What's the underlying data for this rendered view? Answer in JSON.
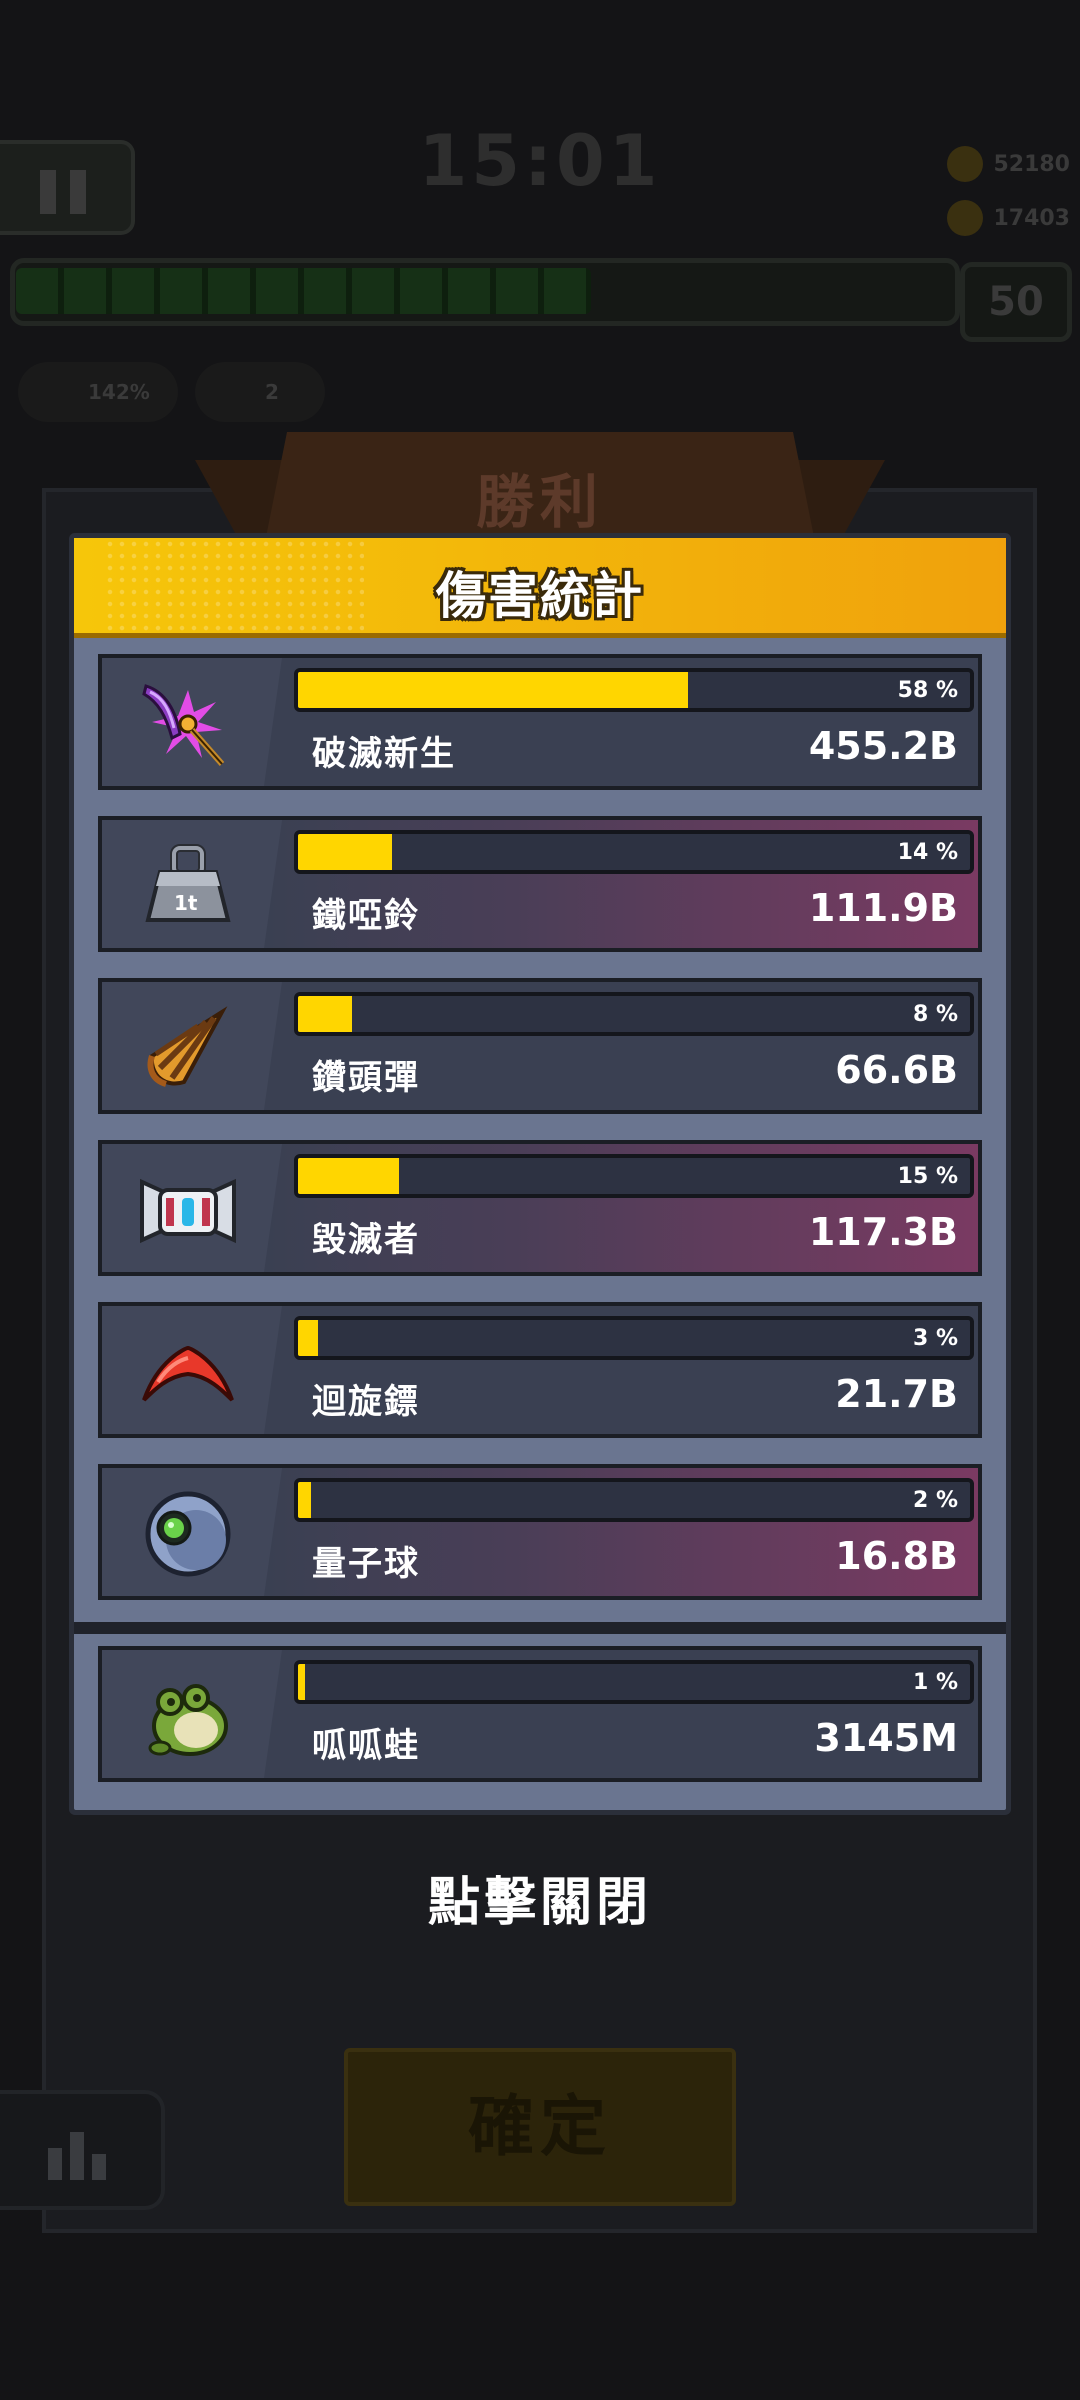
{
  "hud": {
    "timer": "15:01",
    "coins": "52180",
    "kills": "17403",
    "level": "50",
    "stat_a": "142%",
    "stat_b": "2"
  },
  "victory": {
    "title": "勝利"
  },
  "damage_panel": {
    "title": "傷害統計",
    "rows": [
      {
        "name": "破滅新生",
        "percent": 58,
        "percent_label": "58 %",
        "damage": "455.2B",
        "icon": "purple-scythe-icon"
      },
      {
        "name": "鐵啞鈴",
        "percent": 14,
        "percent_label": "14 %",
        "damage": "111.9B",
        "icon": "iron-dumbbell-icon"
      },
      {
        "name": "鑽頭彈",
        "percent": 8,
        "percent_label": "8 %",
        "damage": "66.6B",
        "icon": "drill-bullet-icon"
      },
      {
        "name": "毀滅者",
        "percent": 15,
        "percent_label": "15 %",
        "damage": "117.3B",
        "icon": "destroyer-robot-icon"
      },
      {
        "name": "迴旋鏢",
        "percent": 3,
        "percent_label": "3 %",
        "damage": "21.7B",
        "icon": "boomerang-icon"
      },
      {
        "name": "量子球",
        "percent": 2,
        "percent_label": "2 %",
        "damage": "16.8B",
        "icon": "quantum-orb-icon"
      }
    ],
    "pet_row": {
      "name": "呱呱蛙",
      "percent": 1,
      "percent_label": "1 %",
      "damage": "3145M",
      "icon": "frog-icon"
    }
  },
  "close_hint": "點擊關閉",
  "confirm_label": "確定",
  "colors": {
    "header": "#f6c60a",
    "bar_fill": "#ffd600",
    "panel": "#6a7590"
  }
}
